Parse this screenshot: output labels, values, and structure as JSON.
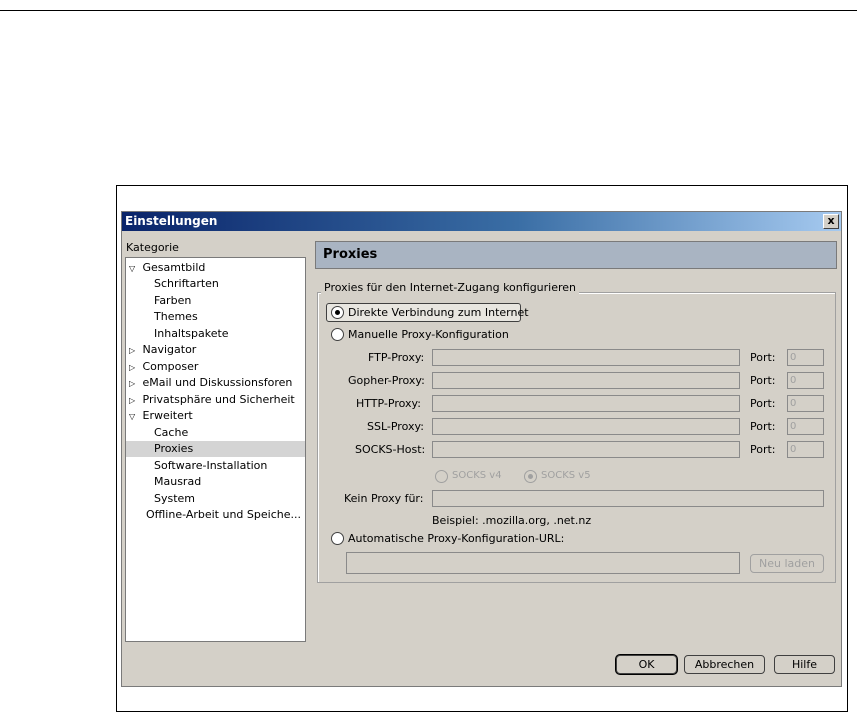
{
  "window": {
    "title": "Einstellungen",
    "close_label": "x"
  },
  "sidebar": {
    "heading": "Kategorie",
    "items": [
      {
        "label": "Gesamtbild",
        "twisty": "▽"
      },
      {
        "label": "Schriftarten"
      },
      {
        "label": "Farben"
      },
      {
        "label": "Themes"
      },
      {
        "label": "Inhaltspakete"
      },
      {
        "label": "Navigator",
        "twisty": "▷"
      },
      {
        "label": "Composer",
        "twisty": "▷"
      },
      {
        "label": "eMail und Diskussionsforen",
        "twisty": "▷"
      },
      {
        "label": "Privatsphäre und Sicherheit",
        "twisty": "▷"
      },
      {
        "label": "Erweitert",
        "twisty": "▽"
      },
      {
        "label": "Cache"
      },
      {
        "label": "Proxies"
      },
      {
        "label": "Software-Installation"
      },
      {
        "label": "Mausrad"
      },
      {
        "label": "System"
      },
      {
        "label": "Offline-Arbeit und Speiche..."
      }
    ]
  },
  "panel": {
    "title": "Proxies",
    "group_label": "Proxies für den Internet-Zugang konfigurieren",
    "radio_direct": "Direkte Verbindung zum Internet",
    "radio_manual": "Manuelle Proxy-Konfiguration",
    "radio_auto": "Automatische Proxy-Konfiguration-URL:",
    "selected_mode": "direct",
    "proxies": [
      {
        "label": "FTP-Proxy:",
        "port_label": "Port:",
        "port_value": "0"
      },
      {
        "label": "Gopher-Proxy:",
        "port_label": "Port:",
        "port_value": "0"
      },
      {
        "label": "HTTP-Proxy:",
        "port_label": "Port:",
        "port_value": "0"
      },
      {
        "label": "SSL-Proxy:",
        "port_label": "Port:",
        "port_value": "0"
      },
      {
        "label": "SOCKS-Host:",
        "port_label": "Port:",
        "port_value": "0"
      }
    ],
    "socks_v4": "SOCKS v4",
    "socks_v5": "SOCKS v5",
    "no_proxy_label": "Kein Proxy für:",
    "example": "Beispiel: .mozilla.org, .net.nz",
    "reload_button": "Neu laden"
  },
  "footer": {
    "ok": "OK",
    "cancel": "Abbrechen",
    "help": "Hilfe"
  }
}
